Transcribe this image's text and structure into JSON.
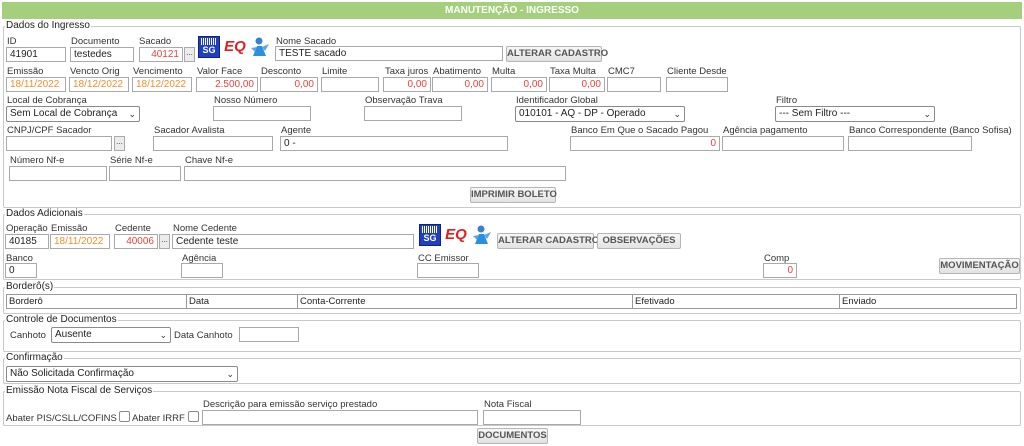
{
  "title": "MANUTENÇÃO - INGRESSO",
  "ingresso": {
    "legend": "Dados do Ingresso",
    "id_label": "ID",
    "id_value": "41901",
    "documento_label": "Documento",
    "documento_value": "testedes",
    "sacado_label": "Sacado",
    "sacado_value": "40121",
    "nome_sacado_label": "Nome Sacado",
    "nome_sacado_value": "TESTE sacado",
    "alterar_cadastro": "ALTERAR CADASTRO",
    "emissao_label": "Emissão",
    "emissao_value": "18/11/2022",
    "vencto_orig_label": "Vencto Orig",
    "vencto_orig_value": "18/12/2022",
    "vencimento_label": "Vencimento",
    "vencimento_value": "18/12/2022",
    "valor_face_label": "Valor Face",
    "valor_face_value": "2.500,00",
    "desconto_label": "Desconto",
    "desconto_value": "0,00",
    "limite_label": "Limite",
    "limite_value": "",
    "taxa_juros_label": "Taxa juros",
    "taxa_juros_value": "0,00",
    "abatimento_label": "Abatimento",
    "abatimento_value": "0,00",
    "multa_label": "Multa",
    "multa_value": "0,00",
    "taxa_multa_label": "Taxa Multa",
    "taxa_multa_value": "0,00",
    "cmc7_label": "CMC7",
    "cmc7_value": "",
    "cliente_desde_label": "Cliente Desde",
    "cliente_desde_value": "",
    "local_cobranca_label": "Local de Cobrança",
    "local_cobranca_value": "Sem Local de Cobrança",
    "nosso_numero_label": "Nosso Número",
    "nosso_numero_value": "",
    "observacao_trava_label": "Observação Trava",
    "observacao_trava_value": "",
    "identificador_global_label": "Identificador Global",
    "identificador_global_value": "010101 - AQ - DP - Operado",
    "filtro_label": "Filtro",
    "filtro_value": "--- Sem Filtro ---",
    "cnpj_label": "CNPJ/CPF Sacador",
    "cnpj_value": "",
    "sacador_avalista_label": "Sacador Avalista",
    "sacador_avalista_value": "",
    "agente_label": "Agente",
    "agente_value": "0 -",
    "banco_sacado_label": "Banco Em Que o Sacado Pagou",
    "banco_sacado_value": "0",
    "agencia_pagamento_label": "Agência pagamento",
    "agencia_pagamento_value": "",
    "banco_correspondente_label": "Banco Correspondente (Banco Sofisa)",
    "banco_correspondente_value": "",
    "numero_nfe_label": "Número Nf-e",
    "numero_nfe_value": "",
    "serie_nfe_label": "Série Nf-e",
    "serie_nfe_value": "",
    "chave_nfe_label": "Chave Nf-e",
    "chave_nfe_value": "",
    "imprimir_boleto": "IMPRIMIR BOLETO"
  },
  "adicionais": {
    "legend": "Dados Adicionais",
    "operacao_label": "Operação",
    "operacao_value": "40185",
    "emissao_label": "Emissão",
    "emissao_value": "18/11/2022",
    "cedente_label": "Cedente",
    "cedente_value": "40006",
    "nome_cedente_label": "Nome Cedente",
    "nome_cedente_value": "Cedente teste",
    "alterar_cadastro": "ALTERAR CADASTRO",
    "observacoes": "OBSERVAÇÕES",
    "banco_label": "Banco",
    "banco_value": "0",
    "agencia_label": "Agência",
    "agencia_value": "",
    "cc_emissor_label": "CC Emissor",
    "cc_emissor_value": "",
    "comp_label": "Comp",
    "comp_value": "0",
    "movimentacao": "MOVIMENTAÇÃO"
  },
  "borderos": {
    "legend": "Borderô(s)",
    "columns": [
      "Borderô",
      "Data",
      "Conta-Corrente",
      "Efetivado",
      "Enviado"
    ]
  },
  "controle": {
    "legend": "Controle de Documentos",
    "canhoto_label": "Canhoto",
    "canhoto_value": "Ausente",
    "data_canhoto_label": "Data Canhoto",
    "data_canhoto_value": ""
  },
  "confirmacao": {
    "legend": "Confirmação",
    "value": "Não Solicitada Confirmação"
  },
  "nota_fiscal": {
    "legend": "Emissão Nota Fiscal de Serviços",
    "abater_pis_label": "Abater PIS/CSLL/COFINS",
    "abater_irrf_label": "Abater IRRF",
    "descricao_label": "Descrição para emissão serviço prestado",
    "descricao_value": "",
    "nota_fiscal_label": "Nota Fiscal",
    "nota_fiscal_value": ""
  },
  "documentos": "DOCUMENTOS",
  "icons": {
    "sg_text": "SG",
    "eq_text": "EQ"
  },
  "colors": {
    "header_bg": "#a4cf7c",
    "red_value": "#e8433c",
    "orange_value": "#f0902a"
  }
}
